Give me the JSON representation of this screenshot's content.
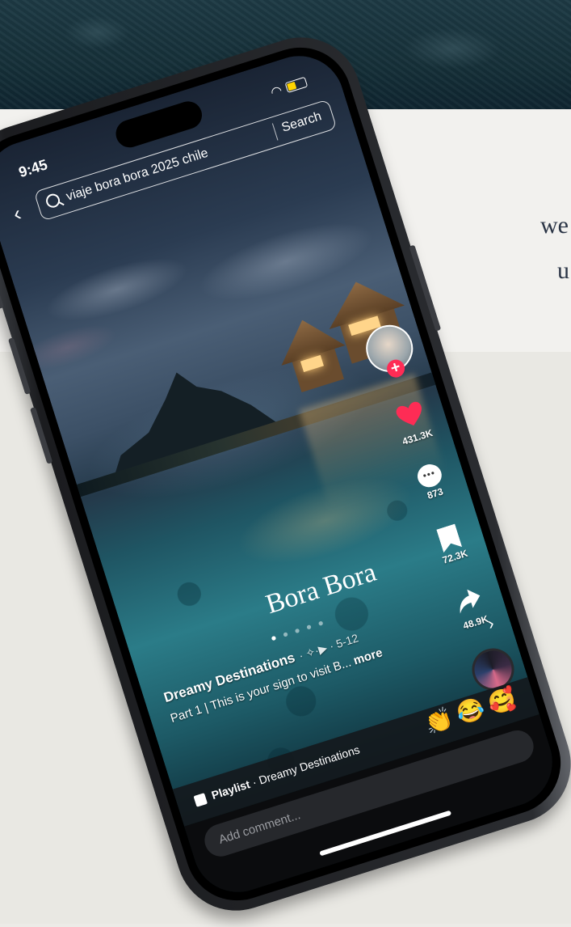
{
  "background": {
    "side_text_line1": "we",
    "side_text_line2": "u"
  },
  "status_bar": {
    "time": "9:45",
    "wifi_icon": "wifi-icon",
    "battery_color": "#ffd400"
  },
  "search": {
    "back_icon": "‹",
    "query": "viaje bora bora 2025 chile",
    "button_label": "Search"
  },
  "video": {
    "overlay_title": "Bora Bora",
    "page_dots": [
      "●",
      "●",
      "●",
      "●",
      "●"
    ]
  },
  "actions": {
    "follow_symbol": "+",
    "likes": "431.3K",
    "comments": "873",
    "saves": "72.3K",
    "shares": "48.9K",
    "like_color": "#fe2c55"
  },
  "caption": {
    "creator": "Dreamy Destinations",
    "meta": "· ✧·▶ · 5-12",
    "description": "Part 1 | This is your sign to visit B...",
    "more": "more",
    "chevron": "›"
  },
  "playlist": {
    "label": "Playlist",
    "name": "· Dreamy Destinations",
    "emojis": "👏😂🥰"
  },
  "comment": {
    "placeholder": "Add comment..."
  }
}
